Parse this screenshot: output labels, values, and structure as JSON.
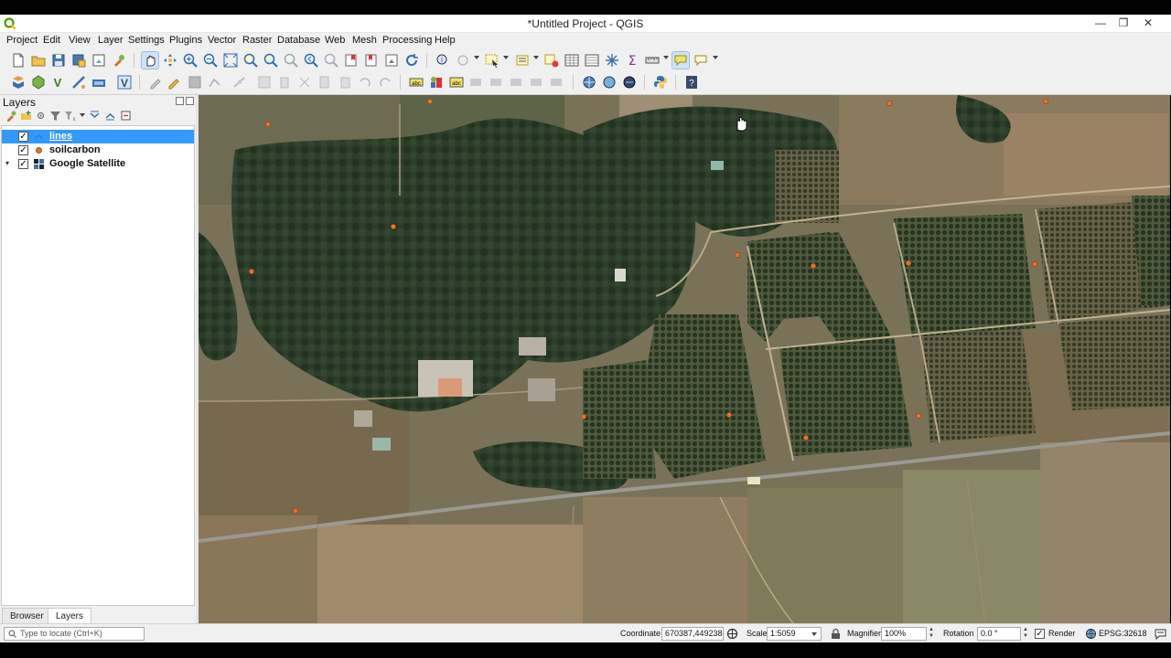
{
  "window": {
    "title": "*Untitled Project - QGIS",
    "minimize_glyph": "—",
    "maximize_glyph": "❐",
    "close_glyph": "✕"
  },
  "menu": [
    "Project",
    "Edit",
    "View",
    "Layer",
    "Settings",
    "Plugins",
    "Vector",
    "Raster",
    "Database",
    "Web",
    "Mesh",
    "Processing",
    "Help"
  ],
  "layers_panel": {
    "title": "Layers",
    "layers": [
      {
        "name": "lines",
        "checked": true,
        "selected": true,
        "symbol": "line"
      },
      {
        "name": "soilcarbon",
        "checked": true,
        "selected": false,
        "symbol": "point"
      },
      {
        "name": "Google Satellite",
        "checked": true,
        "selected": false,
        "symbol": "raster",
        "expandable": true
      }
    ],
    "tabs": [
      "Browser",
      "Layers"
    ],
    "active_tab": "Layers",
    "check_glyph": "✓",
    "expand_glyph": "▾"
  },
  "statusbar": {
    "locate_placeholder": "Type to locate (Ctrl+K)",
    "coordinate_label": "Coordinate",
    "coordinate_value": "670387,449238",
    "scale_label": "Scale",
    "scale_value": "1:5059",
    "magnifier_label": "Magnifier",
    "magnifier_value": "100%",
    "rotation_label": "Rotation",
    "rotation_value": "0.0 °",
    "render_label": "Render",
    "render_checked": true,
    "crs_value": "EPSG:32618"
  },
  "icons": {
    "toolbar1": [
      "new-project-icon",
      "open-project-icon",
      "save-project-icon",
      "save-as-icon",
      "new-print-layout-icon",
      "style-manager-icon",
      "pan-map-icon",
      "pan-to-selection-icon",
      "zoom-in-icon",
      "zoom-out-icon",
      "zoom-full-icon",
      "zoom-to-selection-icon",
      "zoom-to-layer-icon",
      "zoom-native-icon",
      "zoom-last-icon",
      "zoom-next-icon",
      "new-bookmark-icon",
      "show-bookmarks-icon",
      "refresh-icon",
      "identify-icon",
      "action-icon",
      "select-features-icon",
      "select-by-value-icon",
      "deselect-icon",
      "attribute-table-icon",
      "field-calculator-icon",
      "statistics-icon",
      "measure-icon",
      "map-tips-icon",
      "text-annotation-icon"
    ],
    "toolbar2": [
      "data-source-manager-icon",
      "new-geopackage-layer-icon",
      "new-shapefile-layer-icon",
      "new-temporary-layer-icon",
      "new-spatialite-layer-icon",
      "new-virtual-layer-icon",
      "current-edits-icon",
      "toggle-editing-icon",
      "save-edits-icon",
      "digitize-icon",
      "vertex-tool-icon",
      "delete-selected-icon",
      "cut-features-icon",
      "copy-features-icon",
      "paste-features-icon",
      "undo-icon",
      "redo-icon",
      "label-tool-icon",
      "layer-labeling-icon",
      "layer-diagram-icon",
      "pin-labels-icon",
      "show-hide-labels-icon",
      "move-label-icon",
      "rotate-label-icon",
      "change-label-icon",
      "metasearch-icon",
      "osm-place-search-icon",
      "globe-icon",
      "python-console-icon",
      "help-icon"
    ],
    "map_cursor": "pan-hand-icon"
  },
  "colors": {
    "selection": "#3399ff",
    "soil_point": "#e8722e",
    "chrome": "#f0f0f0"
  }
}
